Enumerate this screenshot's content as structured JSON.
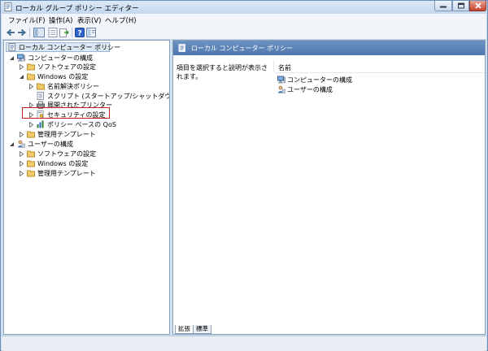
{
  "window": {
    "title": "ローカル グループ ポリシー エディター"
  },
  "menu": [
    "ファイル(F)",
    "操作(A)",
    "表示(V)",
    "ヘルプ(H)"
  ],
  "toolbar": {
    "icons": [
      "back-arrow-icon",
      "forward-arrow-icon",
      "show-hide-tree-icon",
      "properties-icon",
      "export-list-icon",
      "help-icon",
      "extended-view-icon"
    ]
  },
  "tree": {
    "root": "ローカル コンピューター ポリシー",
    "computer_config": "コンピューターの構成",
    "software_settings": "ソフトウェアの設定",
    "windows_settings": "Windows の設定",
    "name_resolution_policy": "名前解決ポリシー",
    "scripts": "スクリプト (スタートアップ/シャットダウン)",
    "deployed_printers": "展開されたプリンター",
    "security_settings": "セキュリティの設定",
    "qos_policy": "ポリシー ベースの QoS",
    "admin_templates": "管理用テンプレート",
    "user_config": "ユーザーの構成",
    "user_software_settings": "ソフトウェアの設定",
    "user_windows_settings": "Windows の設定",
    "user_admin_templates": "管理用テンプレート"
  },
  "right_pane": {
    "header": "ローカル コンピューター ポリシー",
    "description": "項目を選択すると説明が表示されます。",
    "column_name": "名前",
    "items": [
      "コンピューターの構成",
      "ユーザーの構成"
    ]
  },
  "tabs": [
    "拡張",
    "標準"
  ],
  "colors": {
    "highlight_border": "#c41b1b",
    "header_bg": "#5a82b6",
    "window_frame": "#cfe0f1"
  }
}
